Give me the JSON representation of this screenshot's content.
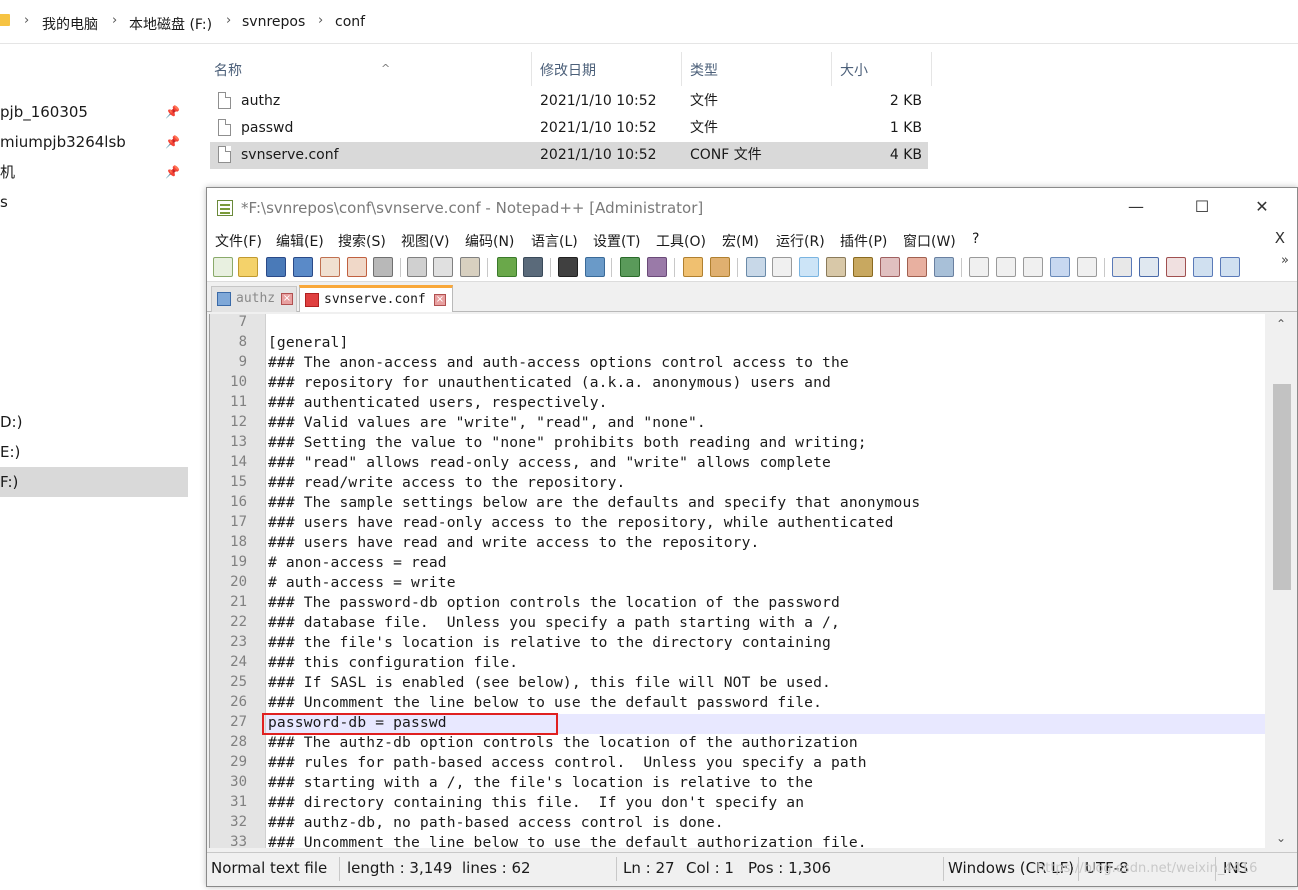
{
  "explorer": {
    "breadcrumb": [
      "我的电脑",
      "本地磁盘 (F:)",
      "svnrepos",
      "conf"
    ],
    "nav_items": [
      {
        "label": "pjb_160305",
        "pinned": true
      },
      {
        "label": "miumpjb3264lsb",
        "pinned": true
      },
      {
        "label": "机",
        "pinned": true
      },
      {
        "label": "s",
        "pinned": false
      },
      {
        "label": "D:)",
        "pinned": false
      },
      {
        "label": "E:)",
        "pinned": false
      },
      {
        "label": "F:)",
        "pinned": false,
        "selected": true
      }
    ],
    "columns": {
      "name": "名称",
      "modified": "修改日期",
      "type": "类型",
      "size": "大小"
    },
    "files": [
      {
        "name": "authz",
        "modified": "2021/1/10 10:52",
        "type": "文件",
        "size": "2 KB"
      },
      {
        "name": "passwd",
        "modified": "2021/1/10 10:52",
        "type": "文件",
        "size": "1 KB"
      },
      {
        "name": "svnserve.conf",
        "modified": "2021/1/10 10:52",
        "type": "CONF 文件",
        "size": "4 KB",
        "selected": true
      }
    ]
  },
  "notepad": {
    "title": "*F:\\svnrepos\\conf\\svnserve.conf - Notepad++ [Administrator]",
    "window_buttons": {
      "minimize": "—",
      "maximize": "☐",
      "close": "✕"
    },
    "menu": [
      "文件(F)",
      "编辑(E)",
      "搜索(S)",
      "视图(V)",
      "编码(N)",
      "语言(L)",
      "设置(T)",
      "工具(O)",
      "宏(M)",
      "运行(R)",
      "插件(P)",
      "窗口(W)",
      "?"
    ],
    "menu_close": "X",
    "toolbar_more": "»",
    "tabs": [
      {
        "label": "authz",
        "active": false
      },
      {
        "label": "svnserve.conf",
        "active": true
      }
    ],
    "lines": [
      {
        "num": "7",
        "text": ""
      },
      {
        "num": "8",
        "text": "[general]"
      },
      {
        "num": "9",
        "text": "### The anon-access and auth-access options control access to the"
      },
      {
        "num": "10",
        "text": "### repository for unauthenticated (a.k.a. anonymous) users and"
      },
      {
        "num": "11",
        "text": "### authenticated users, respectively."
      },
      {
        "num": "12",
        "text": "### Valid values are \"write\", \"read\", and \"none\"."
      },
      {
        "num": "13",
        "text": "### Setting the value to \"none\" prohibits both reading and writing;"
      },
      {
        "num": "14",
        "text": "### \"read\" allows read-only access, and \"write\" allows complete"
      },
      {
        "num": "15",
        "text": "### read/write access to the repository."
      },
      {
        "num": "16",
        "text": "### The sample settings below are the defaults and specify that anonymous"
      },
      {
        "num": "17",
        "text": "### users have read-only access to the repository, while authenticated"
      },
      {
        "num": "18",
        "text": "### users have read and write access to the repository."
      },
      {
        "num": "19",
        "text": "# anon-access = read"
      },
      {
        "num": "20",
        "text": "# auth-access = write"
      },
      {
        "num": "21",
        "text": "### The password-db option controls the location of the password"
      },
      {
        "num": "22",
        "text": "### database file.  Unless you specify a path starting with a /,"
      },
      {
        "num": "23",
        "text": "### the file's location is relative to the directory containing"
      },
      {
        "num": "24",
        "text": "### this configuration file."
      },
      {
        "num": "25",
        "text": "### If SASL is enabled (see below), this file will NOT be used."
      },
      {
        "num": "26",
        "text": "### Uncomment the line below to use the default password file."
      },
      {
        "num": "27",
        "text": "password-db = passwd"
      },
      {
        "num": "28",
        "text": "### The authz-db option controls the location of the authorization"
      },
      {
        "num": "29",
        "text": "### rules for path-based access control.  Unless you specify a path"
      },
      {
        "num": "30",
        "text": "### starting with a /, the file's location is relative to the"
      },
      {
        "num": "31",
        "text": "### directory containing this file.  If you don't specify an"
      },
      {
        "num": "32",
        "text": "### authz-db, no path-based access control is done."
      },
      {
        "num": "33",
        "text": "### Uncomment the line below to use the default authorization file."
      }
    ],
    "status": {
      "file_type": "Normal text file",
      "length": "length : 3,149",
      "lines": "lines : 62",
      "ln": "Ln : 27",
      "col": "Col : 1",
      "pos": "Pos : 1,306",
      "eol": "Windows (CR LF)",
      "encoding": "UTF-8",
      "mode": "INS"
    },
    "watermark": "https://blog.csdn.net/weixin_4416"
  }
}
